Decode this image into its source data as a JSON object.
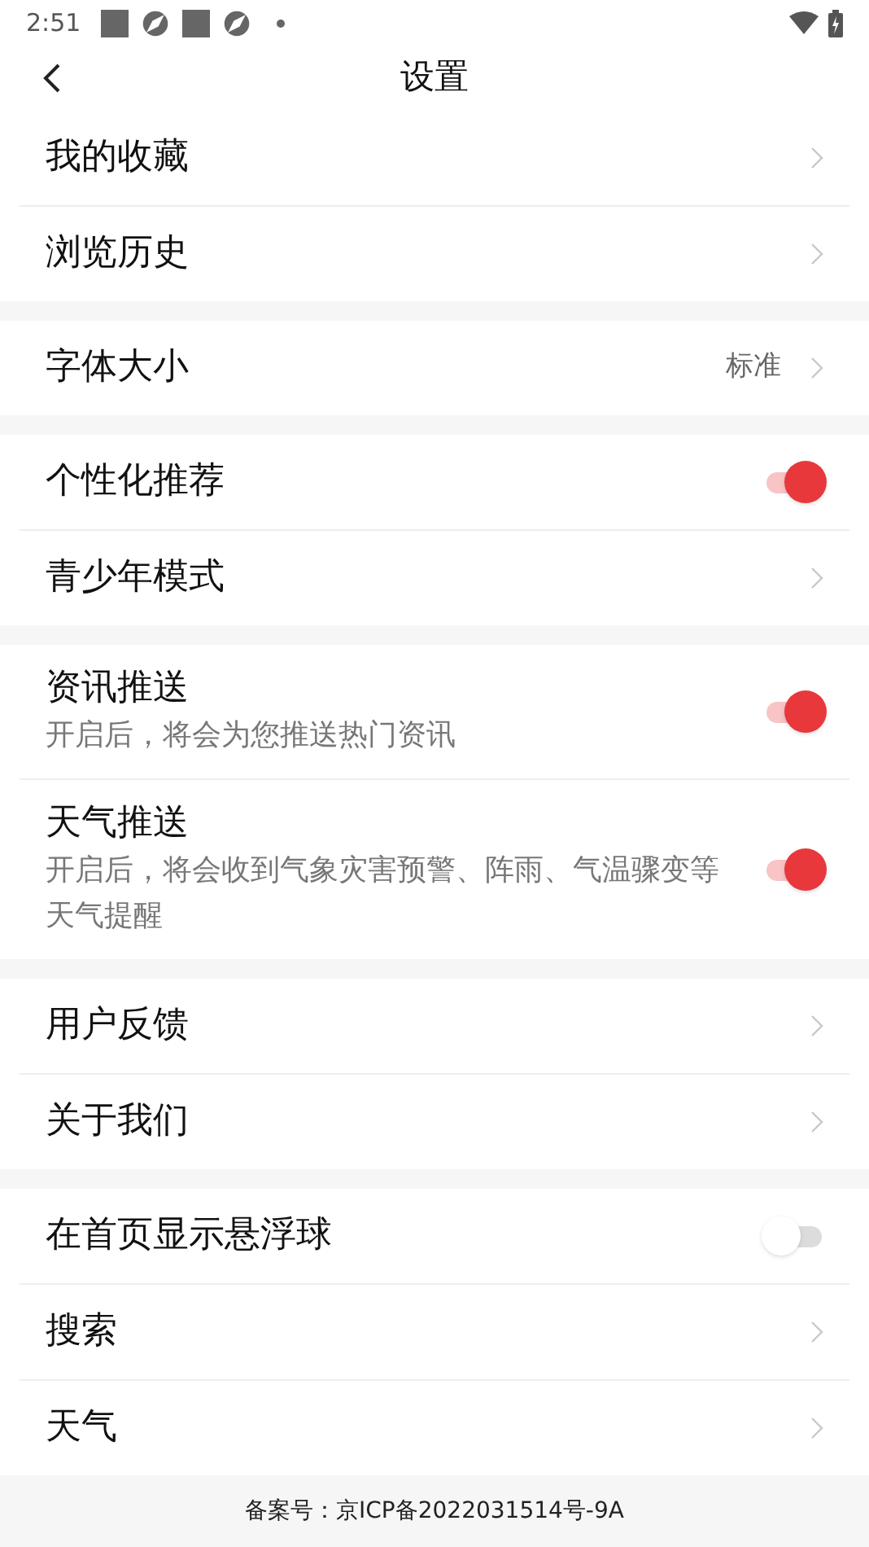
{
  "status_bar": {
    "time": "2:51"
  },
  "header": {
    "title": "设置"
  },
  "groups": [
    {
      "items": [
        {
          "kind": "link",
          "label": "我的收藏"
        },
        {
          "kind": "link",
          "label": "浏览历史"
        }
      ]
    },
    {
      "items": [
        {
          "kind": "value",
          "label": "字体大小",
          "value": "标准"
        }
      ]
    },
    {
      "items": [
        {
          "kind": "toggle",
          "label": "个性化推荐",
          "on": true
        },
        {
          "kind": "link",
          "label": "青少年模式"
        }
      ]
    },
    {
      "items": [
        {
          "kind": "toggle",
          "label": "资讯推送",
          "description": "开启后，将会为您推送热门资讯",
          "on": true
        },
        {
          "kind": "toggle",
          "label": "天气推送",
          "description": "开启后，将会收到气象灾害预警、阵雨、气温骤变等天气提醒",
          "on": true
        }
      ]
    },
    {
      "items": [
        {
          "kind": "link",
          "label": "用户反馈"
        },
        {
          "kind": "link",
          "label": "关于我们"
        }
      ]
    },
    {
      "items": [
        {
          "kind": "toggle",
          "label": "在首页显示悬浮球",
          "on": false
        },
        {
          "kind": "link",
          "label": "搜索"
        },
        {
          "kind": "link",
          "label": "天气"
        }
      ]
    }
  ],
  "footer": {
    "text": "备案号：京ICP备2022031514号-9A"
  }
}
